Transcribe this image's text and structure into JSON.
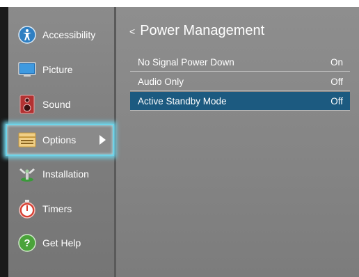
{
  "sidebar": {
    "items": [
      {
        "label": "Accessibility",
        "icon": "accessibility-icon"
      },
      {
        "label": "Picture",
        "icon": "picture-icon"
      },
      {
        "label": "Sound",
        "icon": "speaker-icon"
      },
      {
        "label": "Options",
        "icon": "options-icon",
        "selected": true
      },
      {
        "label": "Installation",
        "icon": "installation-icon"
      },
      {
        "label": "Timers",
        "icon": "timer-icon"
      },
      {
        "label": "Get Help",
        "icon": "help-icon"
      }
    ]
  },
  "panel": {
    "back_glyph": "<",
    "title": "Power Management",
    "settings": [
      {
        "label": "No Signal Power Down",
        "value": "On"
      },
      {
        "label": "Audio Only",
        "value": "Off"
      },
      {
        "label": "Active Standby Mode",
        "value": "Off",
        "highlighted": true
      }
    ]
  },
  "colors": {
    "selection_glow": "#6fd3e8",
    "highlight_row": "#1c5a80",
    "panel_bg": "#8a8a8a"
  }
}
